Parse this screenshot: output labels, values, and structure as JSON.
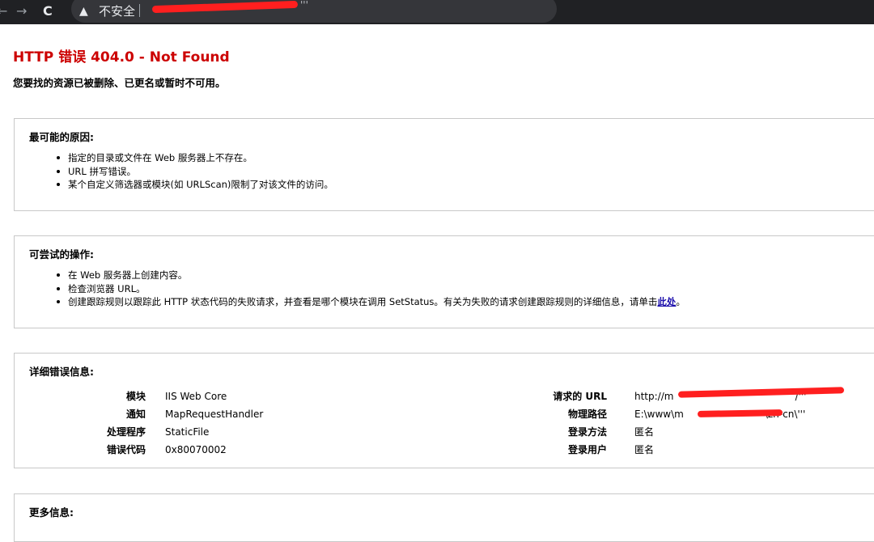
{
  "browser": {
    "back_glyph": "←",
    "forward_glyph": "→",
    "reload_glyph": "C",
    "security_label": "不安全",
    "url_fragment": "'''",
    "icons": [
      "arrow-back-icon",
      "arrow-forward-icon",
      "reload-icon",
      "warning-icon"
    ]
  },
  "page": {
    "title": "HTTP 错误 404.0 - Not Found",
    "subtitle": "您要找的资源已被删除、已更名或暂时不可用。",
    "title_color": "#cc0000"
  },
  "causes": {
    "heading": "最可能的原因:",
    "items": [
      "指定的目录或文件在 Web 服务器上不存在。",
      "URL 拼写错误。",
      "某个自定义筛选器或模块(如 URLScan)限制了对该文件的访问。"
    ]
  },
  "actions": {
    "heading": "可尝试的操作:",
    "items": [
      "在 Web 服务器上创建内容。",
      "检查浏览器 URL。"
    ],
    "item3_text": "创建跟踪规则以跟踪此 HTTP 状态代码的失败请求，并查看是哪个模块在调用 SetStatus。有关为失败的请求创建跟踪规则的详细信息，请单击",
    "item3_link": "此处",
    "item3_end": "。"
  },
  "details": {
    "heading": "详细错误信息:",
    "left": [
      {
        "label": "模块",
        "value": "IIS Web Core"
      },
      {
        "label": "通知",
        "value": "MapRequestHandler"
      },
      {
        "label": "处理程序",
        "value": "StaticFile"
      },
      {
        "label": "错误代码",
        "value": "0x80070002"
      }
    ],
    "right": [
      {
        "label": "请求的 URL",
        "value": "http://m",
        "value_end": "/'''"
      },
      {
        "label": "物理路径",
        "value": "E:\\www\\m",
        "value_end": "\\zh-cn\\'''"
      },
      {
        "label": "登录方法",
        "value": "匿名",
        "value_end": ""
      },
      {
        "label": "登录用户",
        "value": "匿名",
        "value_end": ""
      }
    ]
  },
  "more_info": {
    "heading": "更多信息:"
  }
}
